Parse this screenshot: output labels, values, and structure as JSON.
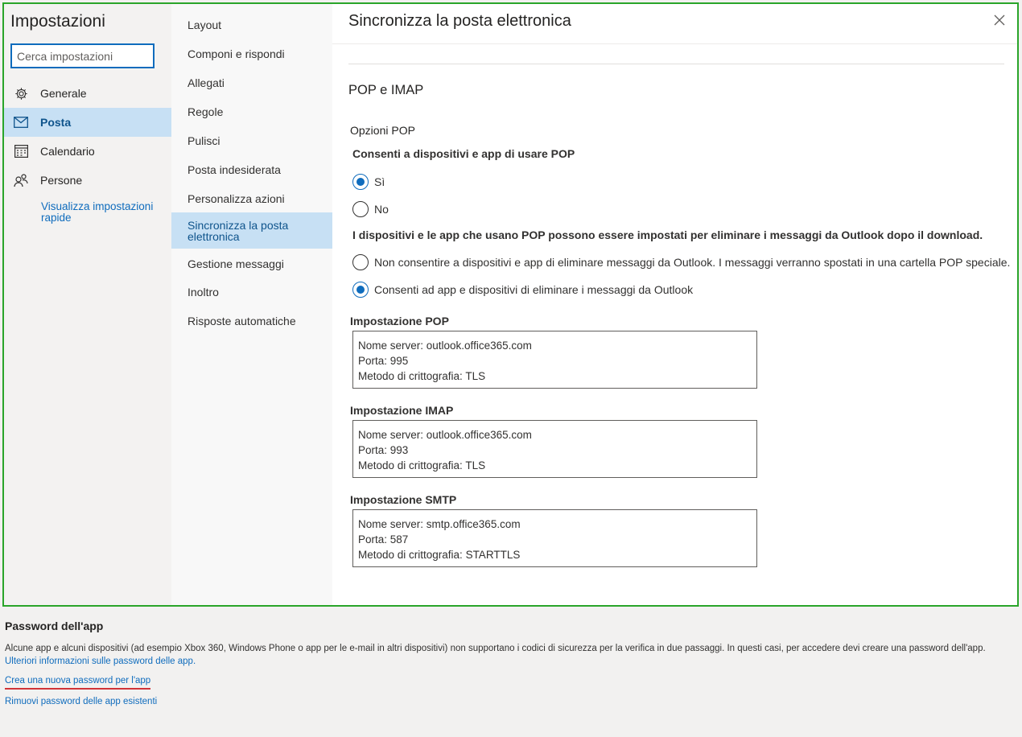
{
  "settings_title": "Impostazioni",
  "search": {
    "placeholder": "Cerca impostazioni"
  },
  "nav_primary": {
    "items": [
      {
        "label": "Generale",
        "icon": "gear-icon"
      },
      {
        "label": "Posta",
        "icon": "mail-icon",
        "active": true
      },
      {
        "label": "Calendario",
        "icon": "calendar-icon"
      },
      {
        "label": "Persone",
        "icon": "people-icon"
      }
    ],
    "quick_settings_link": "Visualizza impostazioni rapide"
  },
  "nav_secondary": {
    "items": [
      "Layout",
      "Componi e rispondi",
      "Allegati",
      "Regole",
      "Pulisci",
      "Posta indesiderata",
      "Personalizza azioni",
      "Sincronizza la posta elettronica",
      "Gestione messaggi",
      "Inoltro",
      "Risposte automatiche"
    ],
    "active_index": 7
  },
  "content": {
    "title": "Sincronizza la posta elettronica",
    "section_title": "POP e IMAP",
    "pop_options_label": "Opzioni POP",
    "pop_question": "Consenti a dispositivi e app di usare POP",
    "pop_yes": "Sì",
    "pop_no": "No",
    "pop_selected": "yes",
    "delete_question": "I dispositivi e le app che usano POP possono essere impostati per eliminare i messaggi da Outlook dopo il download.",
    "delete_option_deny": "Non consentire a dispositivi e app di eliminare messaggi da Outlook. I messaggi verranno spostati in una cartella POP speciale.",
    "delete_option_allow": "Consenti ad app e dispositivi di eliminare i messaggi da Outlook",
    "delete_selected": "allow",
    "pop_setting": {
      "label": "Impostazione POP",
      "server": "Nome server: outlook.office365.com",
      "port": "Porta: 995",
      "encryption": "Metodo di crittografia: TLS"
    },
    "imap_setting": {
      "label": "Impostazione IMAP",
      "server": "Nome server: outlook.office365.com",
      "port": "Porta: 993",
      "encryption": "Metodo di crittografia: TLS"
    },
    "smtp_setting": {
      "label": "Impostazione SMTP",
      "server": "Nome server: smtp.office365.com",
      "port": "Porta: 587",
      "encryption": "Metodo di crittografia: STARTTLS"
    }
  },
  "app_password": {
    "title": "Password dell'app",
    "description": "Alcune app e alcuni dispositivi (ad esempio Xbox 360, Windows Phone o app per le e-mail in altri dispositivi) non supportano i codici di sicurezza per la verifica in due passaggi. In questi casi, per accedere devi creare una password dell'app.",
    "learn_more_link": "Ulteriori informazioni sulle password delle app.",
    "create_link": "Crea una nuova password per l'app",
    "remove_link": "Rimuovi password delle app esistenti"
  },
  "colors": {
    "accent": "#0f6cbd",
    "active_nav": "#c7e0f4",
    "highlight_border": "#2aa52a",
    "underline": "#d13438"
  }
}
